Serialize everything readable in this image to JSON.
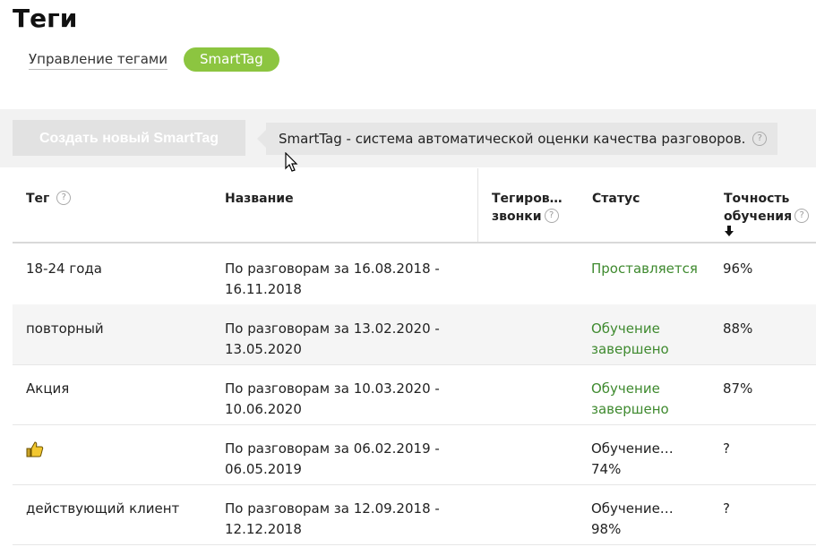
{
  "header": {
    "title": "Теги"
  },
  "subnav": {
    "manage_link": "Управление тегами",
    "active_pill": "SmartTag"
  },
  "toolbar": {
    "create_button": "Создать новый SmartTag",
    "info_text": "SmartTag - система автоматической оценки качества разговоров."
  },
  "table": {
    "columns": {
      "tag": "Тег",
      "name": "Название",
      "tagged_calls_line1": "Тегиров…",
      "tagged_calls_line2": "звонки",
      "status": "Статус",
      "accuracy_line1": "Точность",
      "accuracy_line2": "обучения"
    },
    "rows": [
      {
        "tag": "18-24 года",
        "name_line1": "По разговорам за 16.08.2018 -",
        "name_line2": "16.11.2018",
        "status_line1": "Проставляется",
        "status_line2": "",
        "status_color": "#3f8a2f",
        "accuracy": "96%"
      },
      {
        "tag": "повторный",
        "name_line1": "По разговорам за 13.02.2020 -",
        "name_line2": "13.05.2020",
        "status_line1": "Обучение",
        "status_line2": "завершено",
        "status_color": "#3f8a2f",
        "accuracy": "88%"
      },
      {
        "tag": "Акция",
        "name_line1": "По разговорам за 10.03.2020 -",
        "name_line2": "10.06.2020",
        "status_line1": "Обучение",
        "status_line2": "завершено",
        "status_color": "#3f8a2f",
        "accuracy": "87%"
      },
      {
        "tag": "",
        "tag_icon": "thumbs-up-icon",
        "name_line1": "По разговорам за 06.02.2019 -",
        "name_line2": "06.05.2019",
        "status_line1": "Обучение…",
        "status_line2": "74%",
        "status_color": "#222222",
        "accuracy": "?"
      },
      {
        "tag": "действующий клиент",
        "name_line1": "По разговорам за 12.09.2018 -",
        "name_line2": "12.12.2018",
        "status_line1": "Обучение…",
        "status_line2": "98%",
        "status_color": "#222222",
        "accuracy": "?"
      }
    ]
  },
  "icons": {
    "help": "?",
    "sort": "arrow-down-icon",
    "cursor": "mouse-pointer-icon"
  },
  "colors": {
    "accent_green": "#8cc540",
    "status_green": "#3f8a2f"
  }
}
